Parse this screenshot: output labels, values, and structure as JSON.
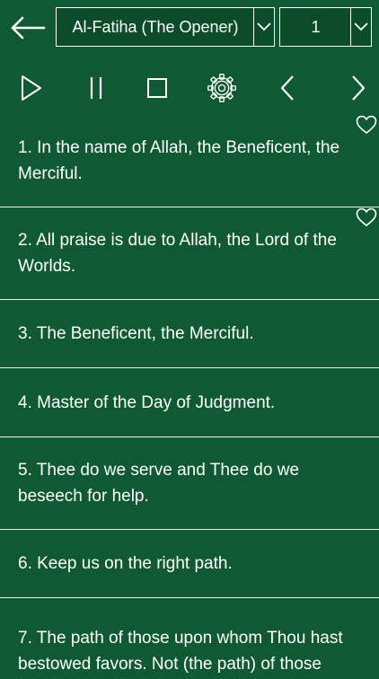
{
  "header": {
    "surah_selected": "Al-Fatiha (The Opener)",
    "verse_selected": "1",
    "back_icon": "back-arrow-icon"
  },
  "controls": [
    "play-icon",
    "pause-icon",
    "stop-icon",
    "settings-gear-icon",
    "previous-icon",
    "next-icon"
  ],
  "verses": [
    {
      "text": "1. In the name of Allah, the Beneficent, the Merciful.",
      "favorite": true
    },
    {
      "text": "2. All praise is due to Allah, the Lord of the Worlds.",
      "favorite": true
    },
    {
      "text": "3. The Beneficent, the Merciful.",
      "favorite": false
    },
    {
      "text": "4. Master of the Day of Judgment.",
      "favorite": false
    },
    {
      "text": "5. Thee do we serve and Thee do we beseech for help.",
      "favorite": false
    },
    {
      "text": "6. Keep us on the right path.",
      "favorite": false
    },
    {
      "text": "7. The path of those upon whom Thou hast bestowed favors. Not (the path) of those",
      "favorite": false
    }
  ],
  "colors": {
    "background": "#0f5a33",
    "foreground": "#ffffff",
    "divider": "#e8efe9"
  }
}
